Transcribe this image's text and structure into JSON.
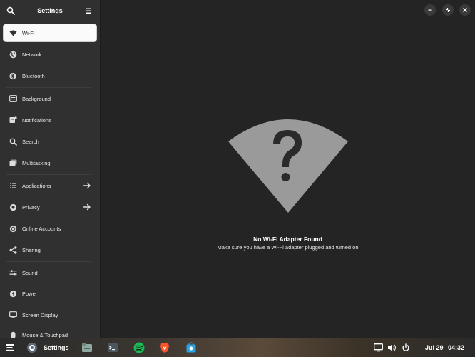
{
  "sidebar": {
    "title": "Settings",
    "items": [
      {
        "label": "Wi-Fi"
      },
      {
        "label": "Network"
      },
      {
        "label": "Bluetooth"
      },
      {
        "label": "Background"
      },
      {
        "label": "Notifications"
      },
      {
        "label": "Search"
      },
      {
        "label": "Multitasking"
      },
      {
        "label": "Applications"
      },
      {
        "label": "Privacy"
      },
      {
        "label": "Online Accounts"
      },
      {
        "label": "Sharing"
      },
      {
        "label": "Sound"
      },
      {
        "label": "Power"
      },
      {
        "label": "Screen Display"
      },
      {
        "label": "Mouse & Touchpad"
      }
    ]
  },
  "main": {
    "message_title": "No Wi-Fi Adapter Found",
    "message_subtitle": "Make sure you have a Wi-Fi adapter plugged and turned on"
  },
  "taskbar": {
    "active_app": "Settings",
    "date": "Jul 29",
    "time": "04:32"
  },
  "colors": {
    "sidebar_bg": "#303030",
    "main_bg": "#242424",
    "illustration": "#9a9a9a",
    "active_item_bg": "#fafafa"
  }
}
